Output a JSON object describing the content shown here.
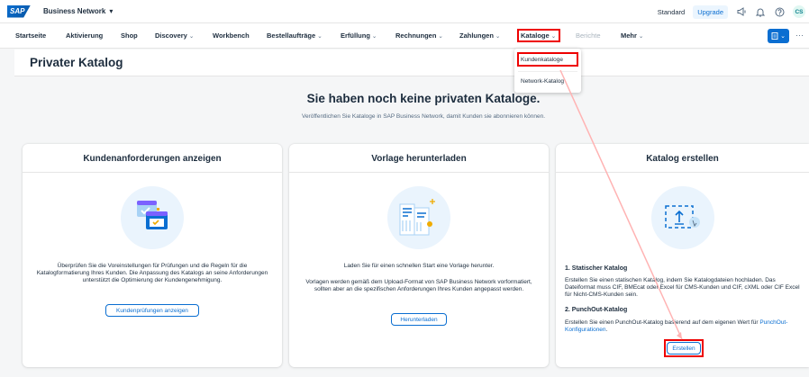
{
  "shell": {
    "logo": "SAP",
    "product": "Business Network",
    "product_chev": "▾",
    "standard": "Standard",
    "upgrade": "Upgrade",
    "avatar": "CS"
  },
  "nav": {
    "items": [
      {
        "label": "Startseite",
        "chev": ""
      },
      {
        "label": "Aktivierung",
        "chev": ""
      },
      {
        "label": "Shop",
        "chev": ""
      },
      {
        "label": "Discovery",
        "chev": "⌄"
      },
      {
        "label": "Workbench",
        "chev": ""
      },
      {
        "label": "Bestellaufträge",
        "chev": "⌄"
      },
      {
        "label": "Erfüllung",
        "chev": "⌄"
      },
      {
        "label": "Rechnungen",
        "chev": "⌄"
      },
      {
        "label": "Zahlungen",
        "chev": "⌄"
      },
      {
        "label": "Kataloge",
        "chev": "⌄"
      },
      {
        "label": "Berichte",
        "chev": ""
      },
      {
        "label": "Mehr",
        "chev": "⌄"
      }
    ],
    "action_button": "⌄",
    "overflow": "···"
  },
  "dropdown": {
    "items": [
      "Kundenkataloge",
      "Network-Katalog"
    ]
  },
  "page": {
    "title": "Privater Katalog",
    "empty_title": "Sie haben noch keine privaten Kataloge.",
    "empty_sub": "Veröffentlichen Sie Kataloge in SAP Business Network, damit Kunden sie abonnieren können."
  },
  "cards": {
    "requirements": {
      "title": "Kundenanforderungen anzeigen",
      "text": "Überprüfen Sie die Voreinstellungen für Prüfungen und die Regeln für die Katalogformatierung Ihres Kunden. Die Anpassung des Katalogs an seine Anforderungen unterstützt die Optimierung der Kundengenehmigung.",
      "button": "Kundenprüfungen anzeigen"
    },
    "template": {
      "title": "Vorlage herunterladen",
      "text1": "Laden Sie für einen schnellen Start eine Vorlage herunter.",
      "text2": "Vorlagen werden gemäß dem Upload-Format von SAP Business Network vorformatiert, sollten aber an die spezifischen Anforderungen Ihres Kunden angepasst werden.",
      "button": "Herunterladen"
    },
    "create": {
      "title": "Katalog erstellen",
      "h1": "1. Statischer Katalog",
      "t1": "Erstellen Sie einen statischen Katalog, indem Sie Katalogdateien hochladen. Das Dateiformat muss CIF, BMEcat oder Excel für CMS-Kunden und CIF, cXML oder CIF Excel für Nicht-CMS-Kunden sein.",
      "h2": "2. PunchOut-Katalog",
      "t2": "Erstellen Sie einen PunchOut-Katalog basierend auf dem eigenen Wert für",
      "t2_link": "PunchOut-Konfigurationen",
      "t2_end": ".",
      "button": "Erstellen"
    }
  },
  "colors": {
    "brand": "#0a6ed1",
    "highlight": "#ee0000"
  }
}
